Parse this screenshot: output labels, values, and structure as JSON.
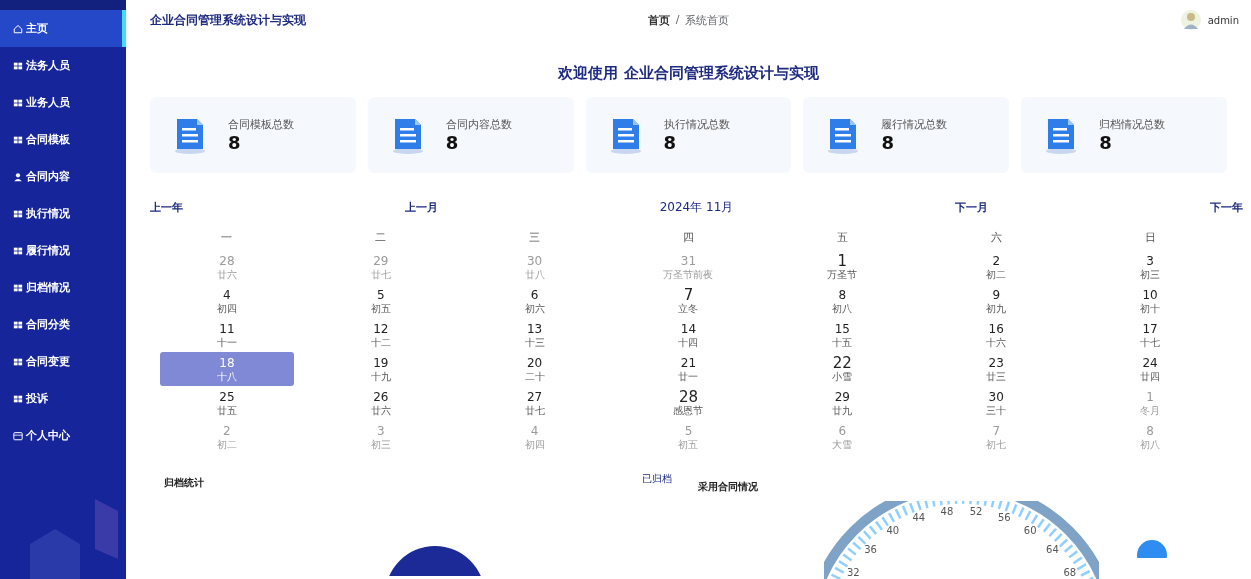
{
  "sidebar": {
    "items": [
      {
        "label": "主页",
        "selected": true
      },
      {
        "label": "法务人员",
        "selected": false
      },
      {
        "label": "业务人员",
        "selected": false
      },
      {
        "label": "合同模板",
        "selected": false
      },
      {
        "label": "合同内容",
        "selected": false
      },
      {
        "label": "执行情况",
        "selected": false
      },
      {
        "label": "履行情况",
        "selected": false
      },
      {
        "label": "归档情况",
        "selected": false
      },
      {
        "label": "合同分类",
        "selected": false
      },
      {
        "label": "合同变更",
        "selected": false
      },
      {
        "label": "投诉",
        "selected": false
      },
      {
        "label": "个人中心",
        "selected": false
      }
    ]
  },
  "header": {
    "title": "企业合同管理系统设计与实现",
    "breadcrumb": [
      "首页",
      "系统首页"
    ],
    "breadcrumb_separator": "/",
    "user": "admin"
  },
  "welcome": "欢迎使用 企业合同管理系统设计与实现",
  "stats": [
    {
      "label": "合同模板总数",
      "value": "8"
    },
    {
      "label": "合同内容总数",
      "value": "8"
    },
    {
      "label": "执行情况总数",
      "value": "8"
    },
    {
      "label": "履行情况总数",
      "value": "8"
    },
    {
      "label": "归档情况总数",
      "value": "8"
    }
  ],
  "calendar": {
    "prev_year": "上一年",
    "prev_month": "上一月",
    "title": "2024年 11月",
    "next_month": "下一月",
    "next_year": "下一年",
    "weekdays": [
      "一",
      "二",
      "三",
      "四",
      "五",
      "六",
      "日"
    ],
    "weeks": [
      [
        {
          "day": "28",
          "lunar": "廿六",
          "muted": true,
          "festival": false,
          "selected": false
        },
        {
          "day": "29",
          "lunar": "廿七",
          "muted": true,
          "festival": false,
          "selected": false
        },
        {
          "day": "30",
          "lunar": "廿八",
          "muted": true,
          "festival": false,
          "selected": false
        },
        {
          "day": "31",
          "lunar": "万圣节前夜",
          "muted": true,
          "festival": false,
          "selected": false
        },
        {
          "day": "1",
          "lunar": "万圣节",
          "muted": false,
          "festival": true,
          "selected": false
        },
        {
          "day": "2",
          "lunar": "初二",
          "muted": false,
          "festival": false,
          "selected": false
        },
        {
          "day": "3",
          "lunar": "初三",
          "muted": false,
          "festival": false,
          "selected": false
        }
      ],
      [
        {
          "day": "4",
          "lunar": "初四",
          "muted": false,
          "festival": false,
          "selected": false
        },
        {
          "day": "5",
          "lunar": "初五",
          "muted": false,
          "festival": false,
          "selected": false
        },
        {
          "day": "6",
          "lunar": "初六",
          "muted": false,
          "festival": false,
          "selected": false
        },
        {
          "day": "7",
          "lunar": "立冬",
          "muted": false,
          "festival": true,
          "selected": false
        },
        {
          "day": "8",
          "lunar": "初八",
          "muted": false,
          "festival": false,
          "selected": false
        },
        {
          "day": "9",
          "lunar": "初九",
          "muted": false,
          "festival": false,
          "selected": false
        },
        {
          "day": "10",
          "lunar": "初十",
          "muted": false,
          "festival": false,
          "selected": false
        }
      ],
      [
        {
          "day": "11",
          "lunar": "十一",
          "muted": false,
          "festival": false,
          "selected": false
        },
        {
          "day": "12",
          "lunar": "十二",
          "muted": false,
          "festival": false,
          "selected": false
        },
        {
          "day": "13",
          "lunar": "十三",
          "muted": false,
          "festival": false,
          "selected": false
        },
        {
          "day": "14",
          "lunar": "十四",
          "muted": false,
          "festival": false,
          "selected": false
        },
        {
          "day": "15",
          "lunar": "十五",
          "muted": false,
          "festival": false,
          "selected": false
        },
        {
          "day": "16",
          "lunar": "十六",
          "muted": false,
          "festival": false,
          "selected": false
        },
        {
          "day": "17",
          "lunar": "十七",
          "muted": false,
          "festival": false,
          "selected": false
        }
      ],
      [
        {
          "day": "18",
          "lunar": "十八",
          "muted": false,
          "festival": false,
          "selected": true
        },
        {
          "day": "19",
          "lunar": "十九",
          "muted": false,
          "festival": false,
          "selected": false
        },
        {
          "day": "20",
          "lunar": "二十",
          "muted": false,
          "festival": false,
          "selected": false
        },
        {
          "day": "21",
          "lunar": "廿一",
          "muted": false,
          "festival": false,
          "selected": false
        },
        {
          "day": "22",
          "lunar": "小雪",
          "muted": false,
          "festival": true,
          "selected": false
        },
        {
          "day": "23",
          "lunar": "廿三",
          "muted": false,
          "festival": false,
          "selected": false
        },
        {
          "day": "24",
          "lunar": "廿四",
          "muted": false,
          "festival": false,
          "selected": false
        }
      ],
      [
        {
          "day": "25",
          "lunar": "廿五",
          "muted": false,
          "festival": false,
          "selected": false
        },
        {
          "day": "26",
          "lunar": "廿六",
          "muted": false,
          "festival": false,
          "selected": false
        },
        {
          "day": "27",
          "lunar": "廿七",
          "muted": false,
          "festival": false,
          "selected": false
        },
        {
          "day": "28",
          "lunar": "感恩节",
          "muted": false,
          "festival": true,
          "selected": false
        },
        {
          "day": "29",
          "lunar": "廿九",
          "muted": false,
          "festival": false,
          "selected": false
        },
        {
          "day": "30",
          "lunar": "三十",
          "muted": false,
          "festival": false,
          "selected": false
        },
        {
          "day": "1",
          "lunar": "冬月",
          "muted": true,
          "festival": false,
          "selected": false
        }
      ],
      [
        {
          "day": "2",
          "lunar": "初二",
          "muted": true,
          "festival": false,
          "selected": false
        },
        {
          "day": "3",
          "lunar": "初三",
          "muted": true,
          "festival": false,
          "selected": false
        },
        {
          "day": "4",
          "lunar": "初四",
          "muted": true,
          "festival": false,
          "selected": false
        },
        {
          "day": "5",
          "lunar": "初五",
          "muted": true,
          "festival": false,
          "selected": false
        },
        {
          "day": "6",
          "lunar": "大雪",
          "muted": true,
          "festival": false,
          "selected": false
        },
        {
          "day": "7",
          "lunar": "初七",
          "muted": true,
          "festival": false,
          "selected": false
        },
        {
          "day": "8",
          "lunar": "初八",
          "muted": true,
          "festival": false,
          "selected": false
        }
      ]
    ]
  },
  "archive_panel": {
    "title": "归档统计",
    "legend": "已归档"
  },
  "usage_panel": {
    "title": "采用合同情况",
    "gauge_labels": [
      "32",
      "36",
      "40",
      "44",
      "48",
      "52",
      "56",
      "60",
      "64",
      "68"
    ]
  }
}
